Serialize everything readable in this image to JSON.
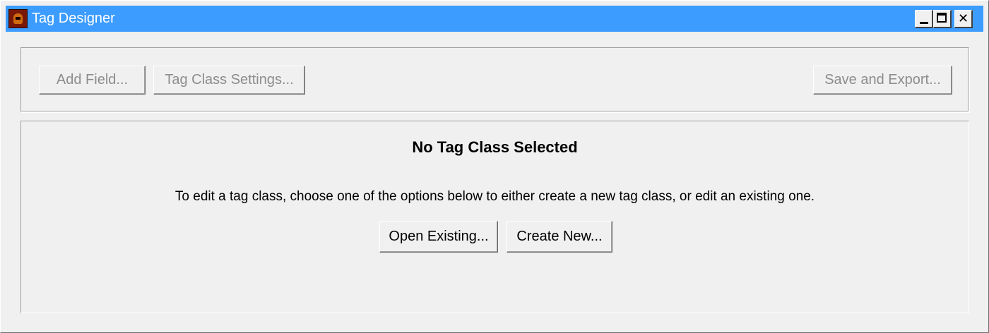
{
  "window": {
    "title": "Tag Designer",
    "icon": "tag-designer-app-icon",
    "controls": {
      "minimize": "minimize-icon",
      "maximize": "maximize-icon",
      "close": "close-icon",
      "close_glyph": "✕"
    }
  },
  "toolbar": {
    "add_field_label": "Add Field...",
    "tag_class_settings_label": "Tag Class Settings...",
    "save_export_label": "Save and Export..."
  },
  "main": {
    "heading": "No Tag Class Selected",
    "description": "To edit a tag class, choose one of the options below to either create a new tag class, or edit an existing one.",
    "open_existing_label": "Open Existing...",
    "create_new_label": "Create New..."
  },
  "colors": {
    "titlebar": "#3c9cff",
    "background": "#f0f0f0",
    "disabled_text": "#8c8c8c"
  }
}
